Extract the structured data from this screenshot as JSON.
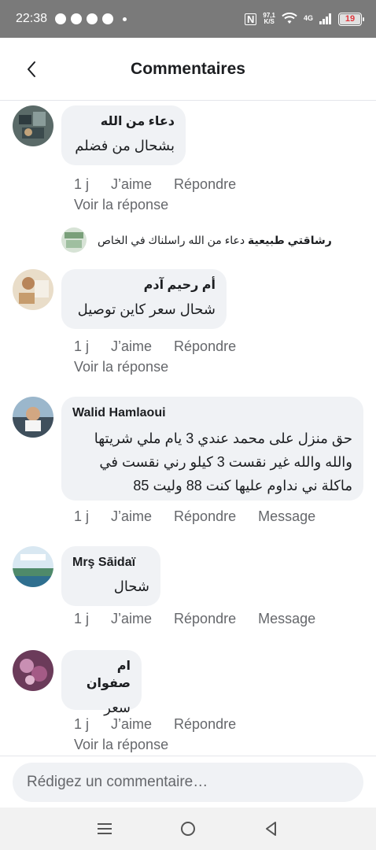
{
  "status_bar": {
    "time": "22:38",
    "net_speed_value": "97,1",
    "net_speed_unit": "K/S",
    "network": "4G",
    "battery": "19"
  },
  "header": {
    "title": "Commentaires"
  },
  "comments": [
    {
      "author": "دعاء من الله",
      "text": "بشحال من فضلم",
      "time": "1 j",
      "like": "J’aime",
      "reply": "Répondre",
      "see_reply": "Voir la réponse"
    },
    {
      "author": "أم رحيم آدم",
      "text": "شحال سعر كاين توصيل",
      "time": "1 j",
      "like": "J’aime",
      "reply": "Répondre",
      "see_reply": "Voir la réponse"
    },
    {
      "author": "Walid Hamlaoui",
      "text_lines": [
        "حق منزل على محمد عندي 3 يام ملي شريتها",
        "والله والله غير نقست 3 كيلو  رني نقست في",
        "ماكلة ني نداوم عليها كنت 88 وليت 85"
      ],
      "time": "1 j",
      "like": "J’aime",
      "reply": "Répondre",
      "message": "Message"
    },
    {
      "author": "Mrş Sāidaï",
      "text": "شحال",
      "time": "1 j",
      "like": "J’aime",
      "reply": "Répondre",
      "message": "Message"
    },
    {
      "author": "ام صفوان",
      "text": "سعر",
      "time": "1 j",
      "like": "J’aime",
      "reply": "Répondre",
      "see_reply": "Voir la réponse"
    }
  ],
  "reply_preview": {
    "author": "رشاقتي طبيعية",
    "text": "دعاء من الله راسلناك في الخاص"
  },
  "composer": {
    "placeholder": "Rédigez un commentaire…"
  }
}
